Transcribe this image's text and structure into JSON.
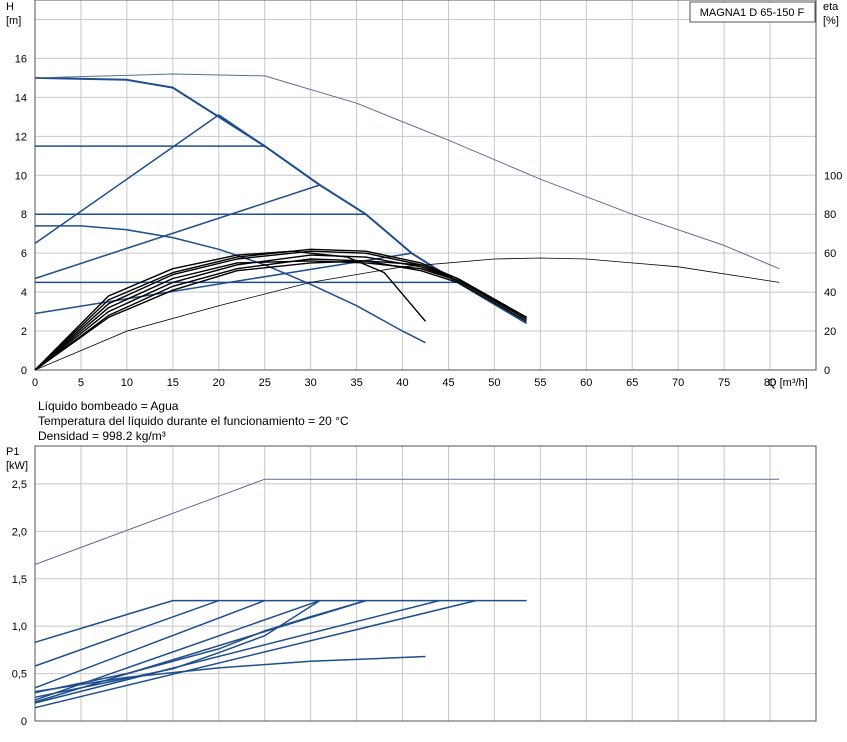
{
  "info": {
    "line1": "Líquido bombeado = Agua",
    "line2": "Temperatura del líquido durante el funcionamiento = 20 °C",
    "line3": "Densidad = 998.2 kg/m³"
  },
  "chart_data": [
    {
      "type": "line",
      "title": "MAGNA1 D 65-150 F",
      "ylabel": "H",
      "yunit": "[m]",
      "y2label": "eta",
      "y2unit": "[%]",
      "xlabel": "Q [m³/h]",
      "xlim": [
        0,
        85
      ],
      "ylim": [
        0,
        19
      ],
      "y2lim": [
        0,
        190
      ],
      "xticks": [
        "0",
        "5",
        "10",
        "15",
        "20",
        "25",
        "30",
        "35",
        "40",
        "45",
        "50",
        "55",
        "60",
        "65",
        "70",
        "75",
        "80"
      ],
      "yticks": [
        "0",
        "2",
        "4",
        "6",
        "8",
        "10",
        "12",
        "14",
        "16"
      ],
      "y2ticks": [
        "0",
        "20",
        "40",
        "60",
        "80",
        "100"
      ],
      "grid": true,
      "colors": {
        "pump": "#1f4e8c",
        "eta": "#000000",
        "envelope": "#5a6f96"
      },
      "series": [
        {
          "role": "max-curve-twin",
          "axis": "H",
          "points": [
            [
              0,
              15.0
            ],
            [
              10,
              14.9
            ],
            [
              15,
              14.5
            ],
            [
              25,
              11.5
            ],
            [
              31,
              9.5
            ],
            [
              36,
              8.0
            ],
            [
              41,
              6.0
            ],
            [
              46,
              4.5
            ],
            [
              53.5,
              2.4
            ]
          ]
        },
        {
          "role": "envelope-twin",
          "axis": "H",
          "points": [
            [
              0,
              15.0
            ],
            [
              8,
              15.1
            ],
            [
              15,
              15.2
            ],
            [
              25,
              15.1
            ],
            [
              35,
              13.7
            ],
            [
              45,
              11.8
            ],
            [
              55,
              9.8
            ],
            [
              65,
              8.0
            ],
            [
              75,
              6.4
            ],
            [
              81,
              5.2
            ]
          ]
        },
        {
          "role": "prop-pressure",
          "axis": "H",
          "points": [
            [
              0,
              6.5
            ],
            [
              20,
              13.1
            ],
            [
              25,
              11.5
            ]
          ]
        },
        {
          "role": "prop-pressure",
          "axis": "H",
          "points": [
            [
              0,
              4.7
            ],
            [
              31,
              9.5
            ]
          ]
        },
        {
          "role": "prop-pressure",
          "axis": "H",
          "points": [
            [
              0,
              2.9
            ],
            [
              41,
              6.0
            ]
          ]
        },
        {
          "role": "const-pressure",
          "axis": "H",
          "points": [
            [
              0,
              11.5
            ],
            [
              25,
              11.5
            ]
          ]
        },
        {
          "role": "const-pressure",
          "axis": "H",
          "points": [
            [
              0,
              8.0
            ],
            [
              36,
              8.0
            ]
          ]
        },
        {
          "role": "const-pressure",
          "axis": "H",
          "points": [
            [
              0,
              4.5
            ],
            [
              46,
              4.5
            ]
          ]
        },
        {
          "role": "max-curve-single",
          "axis": "H",
          "points": [
            [
              0,
              7.4
            ],
            [
              5,
              7.4
            ],
            [
              10,
              7.2
            ],
            [
              15,
              6.8
            ],
            [
              20,
              6.2
            ],
            [
              25,
              5.4
            ],
            [
              30,
              4.4
            ],
            [
              35,
              3.3
            ],
            [
              40,
              2.0
            ],
            [
              42.5,
              1.4
            ]
          ]
        },
        {
          "role": "eta-twin",
          "axis": "eta",
          "points": [
            [
              0,
              0
            ],
            [
              10,
              20
            ],
            [
              20,
              33
            ],
            [
              30,
              45
            ],
            [
              40,
              53
            ],
            [
              50,
              57
            ],
            [
              55,
              57.5
            ],
            [
              60,
              57
            ],
            [
              70,
              53
            ],
            [
              81,
              45
            ]
          ]
        },
        {
          "role": "eta-single",
          "axis": "eta",
          "points": [
            [
              0,
              0
            ],
            [
              8,
              38
            ],
            [
              15,
              52
            ],
            [
              22,
              59
            ],
            [
              28,
              61
            ],
            [
              34,
              58
            ],
            [
              38,
              50
            ],
            [
              42.5,
              25
            ]
          ]
        },
        {
          "role": "eta-single",
          "axis": "eta",
          "points": [
            [
              0,
              0
            ],
            [
              8,
              36
            ],
            [
              15,
              50
            ],
            [
              22,
              58
            ],
            [
              30,
              62
            ],
            [
              36,
              61
            ],
            [
              42,
              55
            ],
            [
              46,
              47
            ],
            [
              53.5,
              27
            ]
          ]
        },
        {
          "role": "eta-single",
          "axis": "eta",
          "points": [
            [
              0,
              0
            ],
            [
              8,
              34
            ],
            [
              15,
              49
            ],
            [
              22,
              57
            ],
            [
              30,
              61
            ],
            [
              36,
              60
            ],
            [
              42,
              54
            ],
            [
              46,
              46
            ],
            [
              53.5,
              27
            ]
          ]
        },
        {
          "role": "eta-single",
          "axis": "eta",
          "points": [
            [
              0,
              0
            ],
            [
              8,
              32
            ],
            [
              15,
              47
            ],
            [
              22,
              55
            ],
            [
              30,
              56
            ],
            [
              36,
              55
            ],
            [
              42,
              52
            ],
            [
              46,
              46
            ],
            [
              53.5,
              26
            ]
          ]
        },
        {
          "role": "eta-single",
          "axis": "eta",
          "points": [
            [
              0,
              0
            ],
            [
              8,
              30
            ],
            [
              15,
              45
            ],
            [
              22,
              54
            ],
            [
              30,
              59
            ],
            [
              36,
              58
            ],
            [
              42,
              53
            ],
            [
              46,
              46
            ],
            [
              53.5,
              26
            ]
          ]
        },
        {
          "role": "eta-single",
          "axis": "eta",
          "points": [
            [
              0,
              0
            ],
            [
              8,
              28
            ],
            [
              15,
              43
            ],
            [
              22,
              52
            ],
            [
              30,
              57
            ],
            [
              36,
              56
            ],
            [
              42,
              51
            ],
            [
              46,
              45
            ],
            [
              53.5,
              25
            ]
          ]
        },
        {
          "role": "eta-single",
          "axis": "eta",
          "points": [
            [
              0,
              0
            ],
            [
              8,
              27
            ],
            [
              15,
              41
            ],
            [
              22,
              51
            ],
            [
              30,
              55
            ],
            [
              36,
              56
            ],
            [
              42,
              54
            ],
            [
              46,
              47
            ],
            [
              53.5,
              27
            ]
          ]
        }
      ]
    },
    {
      "type": "line",
      "ylabel": "P1",
      "yunit": "[kW]",
      "xlim": [
        0,
        85
      ],
      "ylim": [
        0,
        2.9
      ],
      "yticks": [
        "0",
        "0,5",
        "1,0",
        "1,5",
        "2,0",
        "2,5"
      ],
      "grid": true,
      "colors": {
        "pump": "#1f4e8c",
        "envelope": "#5a6f96"
      },
      "series": [
        {
          "role": "envelope-twin",
          "points": [
            [
              0,
              1.65
            ],
            [
              25,
              2.55
            ],
            [
              81,
              2.55
            ]
          ]
        },
        {
          "role": "max-curve",
          "points": [
            [
              0,
              0.83
            ],
            [
              15,
              1.27
            ],
            [
              53.5,
              1.27
            ]
          ]
        },
        {
          "role": "prop-pressure",
          "points": [
            [
              0,
              0.58
            ],
            [
              20,
              1.27
            ]
          ]
        },
        {
          "role": "prop-pressure",
          "points": [
            [
              0,
              0.35
            ],
            [
              25,
              1.27
            ]
          ]
        },
        {
          "role": "prop-pressure",
          "points": [
            [
              0,
              0.22
            ],
            [
              31,
              1.27
            ]
          ]
        },
        {
          "role": "prop-pressure",
          "points": [
            [
              0,
              0.2
            ],
            [
              36,
              1.27
            ]
          ]
        },
        {
          "role": "prop-pressure",
          "points": [
            [
              0,
              0.19
            ],
            [
              44,
              1.27
            ]
          ]
        },
        {
          "role": "prop-pressure",
          "points": [
            [
              0,
              0.14
            ],
            [
              48,
              1.27
            ]
          ]
        },
        {
          "role": "curve",
          "points": [
            [
              0,
              0.25
            ],
            [
              15,
              0.55
            ],
            [
              20,
              0.72
            ],
            [
              25,
              0.9
            ],
            [
              31,
              1.27
            ]
          ]
        },
        {
          "role": "curve",
          "points": [
            [
              0,
              0.3
            ],
            [
              10,
              0.5
            ],
            [
              20,
              0.76
            ],
            [
              25,
              0.95
            ],
            [
              30,
              1.1
            ],
            [
              36,
              1.27
            ]
          ]
        },
        {
          "role": "max-curve-single",
          "points": [
            [
              0,
              0.31
            ],
            [
              10,
              0.46
            ],
            [
              20,
              0.56
            ],
            [
              30,
              0.63
            ],
            [
              42.5,
              0.68
            ]
          ]
        }
      ]
    }
  ]
}
